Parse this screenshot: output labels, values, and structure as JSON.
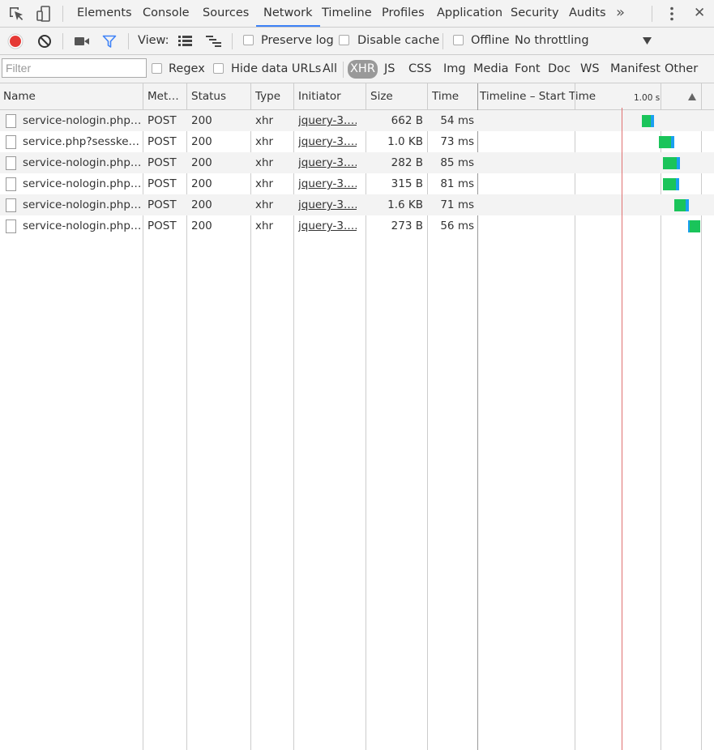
{
  "tabs": [
    "Elements",
    "Console",
    "Sources",
    "Network",
    "Timeline",
    "Profiles",
    "Application",
    "Security",
    "Audits"
  ],
  "more_tabs_glyph": "»",
  "close_glyph": "✕",
  "toolbar": {
    "view_label": "View:",
    "preserve_log_label": "Preserve log",
    "disable_cache_label": "Disable cache",
    "offline_label": "Offline",
    "throttling_value": "No throttling",
    "colors": {
      "record": "#e53935",
      "filter_active": "#3e82f7"
    }
  },
  "filterbar": {
    "placeholder": "Filter",
    "regex_label": "Regex",
    "hide_data_urls_label": "Hide data URLs",
    "types": [
      "All",
      "XHR",
      "JS",
      "CSS",
      "Img",
      "Media",
      "Font",
      "Doc",
      "WS",
      "Manifest",
      "Other"
    ],
    "selected_type": "XHR"
  },
  "grid": {
    "columns": [
      "Name",
      "Met…",
      "Status",
      "Type",
      "Initiator",
      "Size",
      "Time",
      "Timeline – Start Time"
    ],
    "timeline_marker_label": "1.00 s",
    "rows": [
      {
        "name": "service-nologin.php…",
        "method": "POST",
        "status": "200",
        "type": "xhr",
        "initiator": "jquery-3.…",
        "size": "662 B",
        "time": "54 ms"
      },
      {
        "name": "service.php?sesske…",
        "method": "POST",
        "status": "200",
        "type": "xhr",
        "initiator": "jquery-3.…",
        "size": "1.0 KB",
        "time": "73 ms"
      },
      {
        "name": "service-nologin.php…",
        "method": "POST",
        "status": "200",
        "type": "xhr",
        "initiator": "jquery-3.…",
        "size": "282 B",
        "time": "85 ms"
      },
      {
        "name": "service-nologin.php…",
        "method": "POST",
        "status": "200",
        "type": "xhr",
        "initiator": "jquery-3.…",
        "size": "315 B",
        "time": "81 ms"
      },
      {
        "name": "service-nologin.php…",
        "method": "POST",
        "status": "200",
        "type": "xhr",
        "initiator": "jquery-3.…",
        "size": "1.6 KB",
        "time": "71 ms"
      },
      {
        "name": "service-nologin.php…",
        "method": "POST",
        "status": "200",
        "type": "xhr",
        "initiator": "jquery-3.…",
        "size": "273 B",
        "time": "56 ms"
      }
    ],
    "waterfall_colors": {
      "waiting": "#1ac45a",
      "download": "#1a9ff0",
      "load_marker": "#e07070"
    }
  }
}
